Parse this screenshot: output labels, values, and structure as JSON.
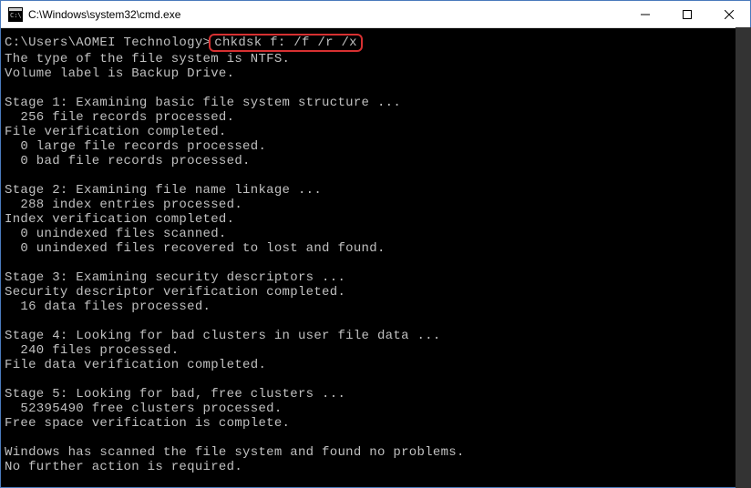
{
  "window": {
    "title": "C:\\Windows\\system32\\cmd.exe"
  },
  "terminal": {
    "prompt": "C:\\Users\\AOMEI Technology>",
    "command": "chkdsk f: /f /r /x",
    "lines": [
      "The type of the file system is NTFS.",
      "Volume label is Backup Drive.",
      "",
      "Stage 1: Examining basic file system structure ...",
      "  256 file records processed.",
      "File verification completed.",
      "  0 large file records processed.",
      "  0 bad file records processed.",
      "",
      "Stage 2: Examining file name linkage ...",
      "  288 index entries processed.",
      "Index verification completed.",
      "  0 unindexed files scanned.",
      "  0 unindexed files recovered to lost and found.",
      "",
      "Stage 3: Examining security descriptors ...",
      "Security descriptor verification completed.",
      "  16 data files processed.",
      "",
      "Stage 4: Looking for bad clusters in user file data ...",
      "  240 files processed.",
      "File data verification completed.",
      "",
      "Stage 5: Looking for bad, free clusters ...",
      "  52395490 free clusters processed.",
      "Free space verification is complete.",
      "",
      "Windows has scanned the file system and found no problems.",
      "No further action is required."
    ]
  }
}
